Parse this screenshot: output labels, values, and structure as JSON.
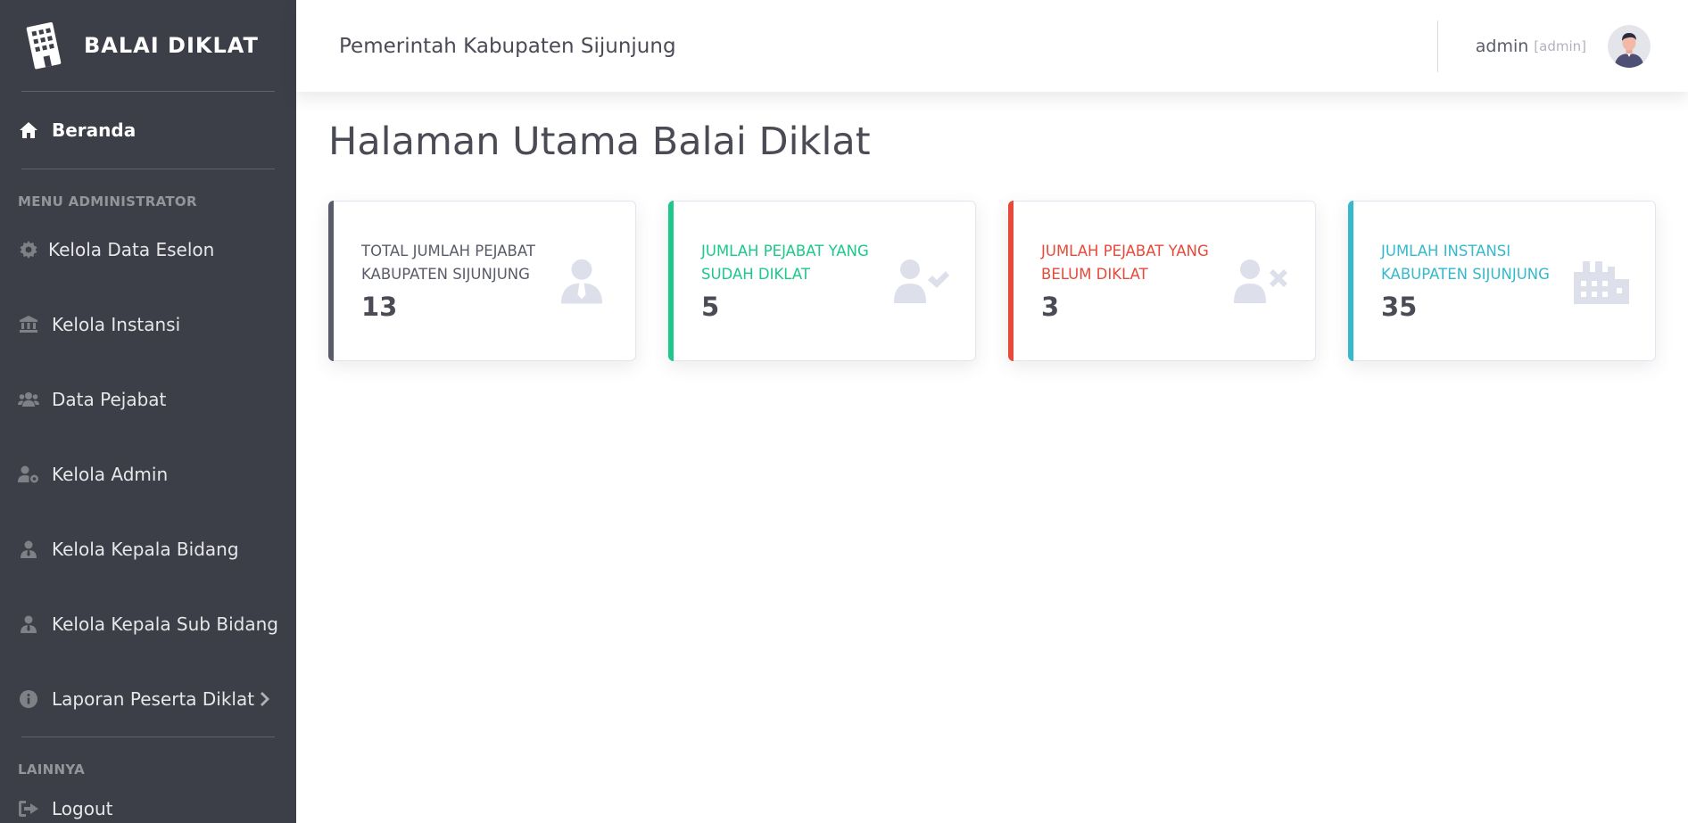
{
  "sidebar": {
    "brand": "BALAI DIKLAT",
    "active_item": {
      "label": "Beranda",
      "icon": "home-icon"
    },
    "section_admin": "MENU ADMINISTRATOR",
    "items": [
      {
        "label": "Kelola Data Eselon",
        "icon": "cog-icon"
      },
      {
        "label": "Kelola Instansi",
        "icon": "landmark-icon"
      },
      {
        "label": "Data Pejabat",
        "icon": "users-icon"
      },
      {
        "label": "Kelola Admin",
        "icon": "user-cog-icon"
      },
      {
        "label": "Kelola Kepala Bidang",
        "icon": "user-tie-icon"
      },
      {
        "label": "Kelola Kepala Sub Bidang",
        "icon": "user-tie-icon"
      },
      {
        "label": "Laporan Peserta Diklat",
        "icon": "info-circle-icon"
      }
    ],
    "section_other": "LAINNYA",
    "logout": "Logout"
  },
  "topbar": {
    "title": "Pemerintah Kabupaten Sijunjung",
    "user_name": "admin",
    "user_role": "[admin]"
  },
  "page": {
    "title": "Halaman Utama Balai Diklat"
  },
  "cards": [
    {
      "label": "TOTAL JUMLAH PEJABAT KABUPATEN SIJUNJUNG",
      "value": "13",
      "color": "#5a5c69",
      "icon": "user-tie-icon"
    },
    {
      "label": "JUMLAH PEJABAT YANG SUDAH DIKLAT",
      "value": "5",
      "color": "#1cc88a",
      "icon": "user-check-icon"
    },
    {
      "label": "JUMLAH PEJABAT YANG BELUM DIKLAT",
      "value": "3",
      "color": "#e74a3b",
      "icon": "user-times-icon"
    },
    {
      "label": "JUMLAH INSTANSI KABUPATEN SIJUNJUNG",
      "value": "35",
      "color": "#36b9cc",
      "icon": "industry-icon"
    }
  ]
}
